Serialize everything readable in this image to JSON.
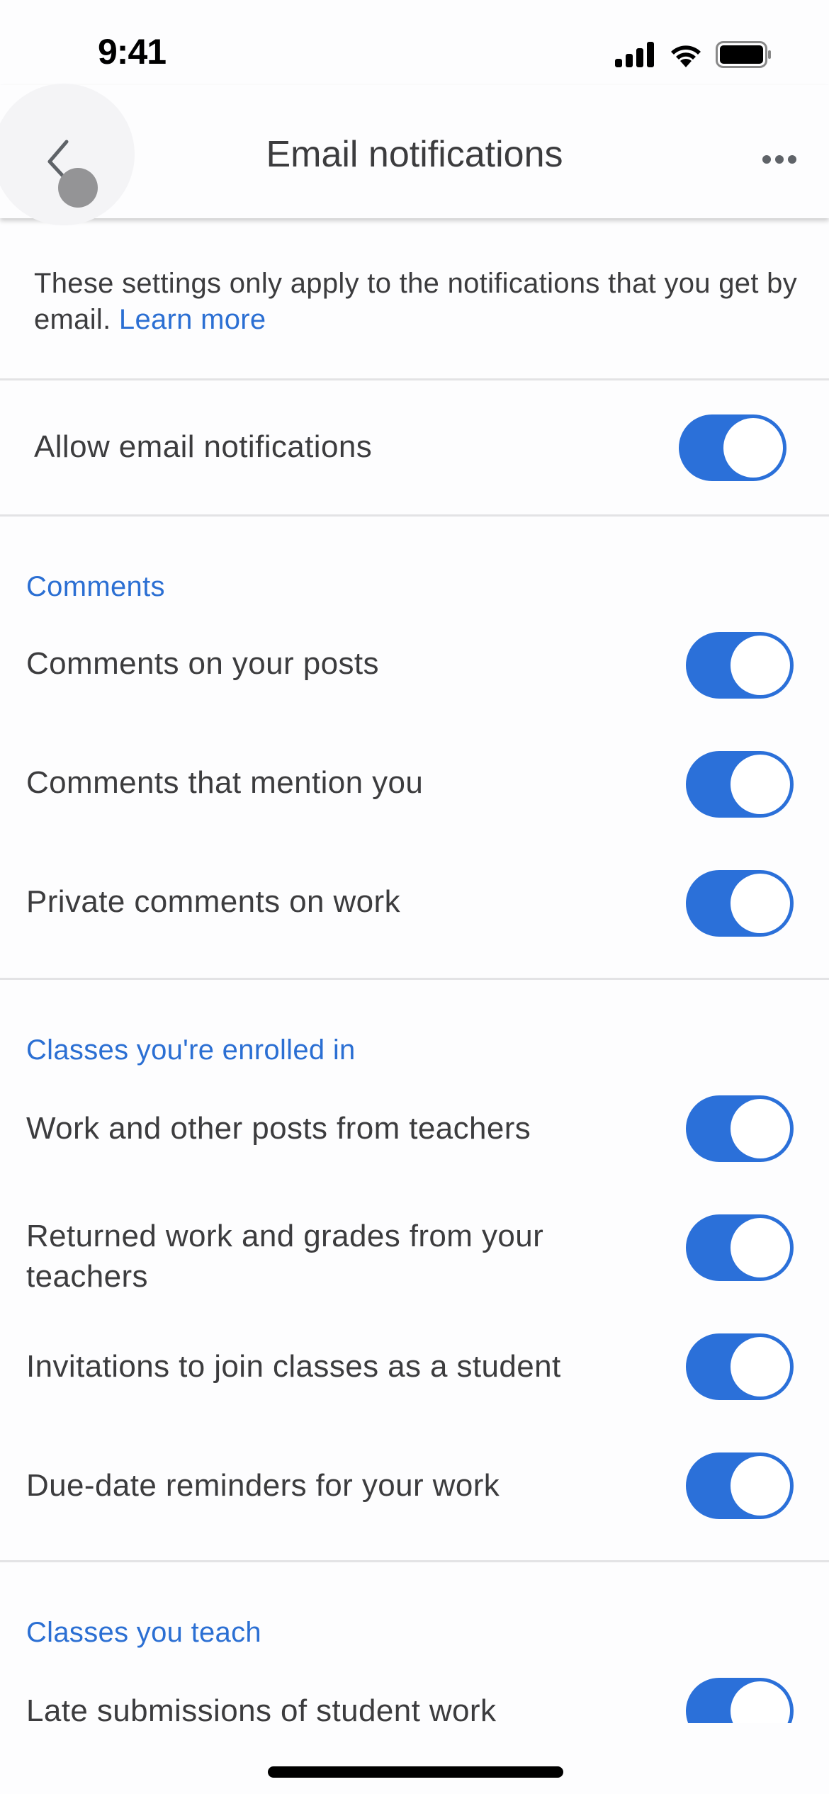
{
  "status_bar": {
    "time": "9:41",
    "icons": [
      "cellular-signal-icon",
      "wifi-icon",
      "battery-icon"
    ]
  },
  "header": {
    "title": "Email notifications",
    "back_icon": "chevron-left-icon",
    "more_icon": "more-horizontal-icon"
  },
  "description": {
    "text": "These settings only apply to the notifications that you get by email.",
    "link_label": "Learn more"
  },
  "master": {
    "label": "Allow email notifications",
    "enabled": true
  },
  "colors": {
    "accent": "#2b70d9",
    "link": "#2b6fd3",
    "text": "#3c3c3e"
  },
  "sections": [
    {
      "title": "Comments",
      "items": [
        {
          "label": "Comments on your posts",
          "enabled": true
        },
        {
          "label": "Comments that mention you",
          "enabled": true
        },
        {
          "label": "Private comments on work",
          "enabled": true
        }
      ]
    },
    {
      "title": "Classes you're enrolled in",
      "items": [
        {
          "label": "Work and other posts from teachers",
          "enabled": true
        },
        {
          "label": "Returned work and grades from your teachers",
          "enabled": true
        },
        {
          "label": "Invitations to join classes as a student",
          "enabled": true
        },
        {
          "label": "Due-date reminders for your work",
          "enabled": true
        }
      ]
    },
    {
      "title": "Classes you teach",
      "items": [
        {
          "label": "Late submissions of student work",
          "enabled": true
        }
      ]
    }
  ]
}
